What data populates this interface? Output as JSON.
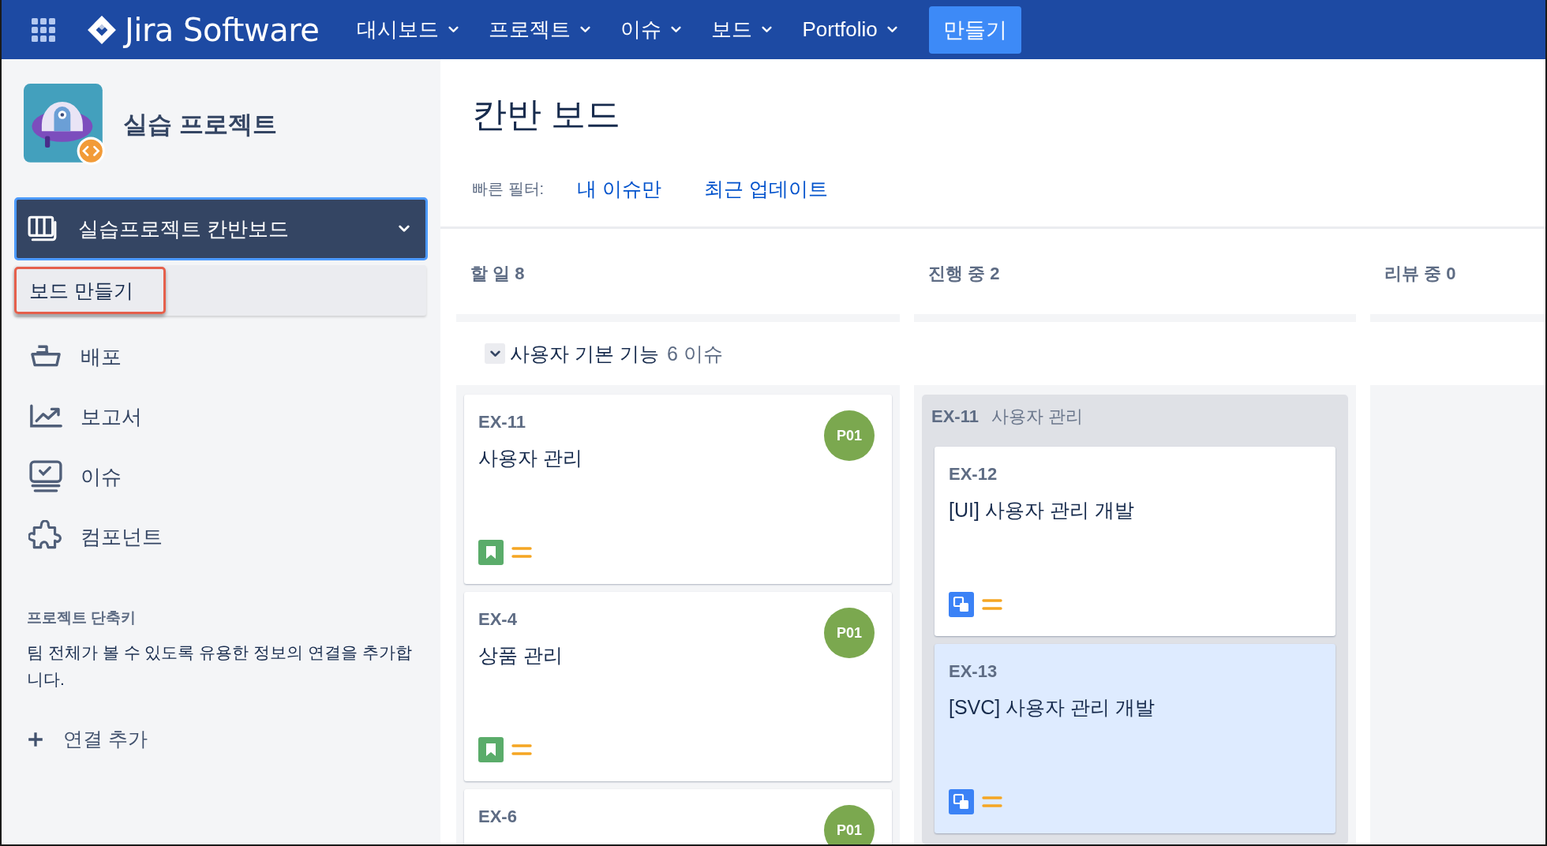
{
  "top_nav": {
    "logo": "Jira Software",
    "menus": [
      {
        "label": "대시보드",
        "dropdown": true
      },
      {
        "label": "프로젝트",
        "dropdown": true
      },
      {
        "label": "이슈",
        "dropdown": true
      },
      {
        "label": "보드",
        "dropdown": true
      },
      {
        "label": "Portfolio",
        "dropdown": true
      }
    ],
    "create_button": "만들기"
  },
  "sidebar": {
    "project_name": "실습 프로젝트",
    "board_selector": {
      "label": "실습프로젝트 칸반보드",
      "expanded": true
    },
    "dropdown_items": [
      {
        "label": "보드 만들기",
        "highlighted": true
      }
    ],
    "items": [
      {
        "label": "배포",
        "kind": "ship"
      },
      {
        "label": "보고서",
        "kind": "chart"
      },
      {
        "label": "이슈",
        "kind": "issues"
      },
      {
        "label": "컴포넌트",
        "kind": "puzzle"
      }
    ],
    "shortcuts": {
      "heading": "프로젝트 단축키",
      "description": "팀 전체가 볼 수 있도록 유용한 정보의 연결을 추가합니다.",
      "add_link": "연결 추가"
    }
  },
  "board": {
    "title": "칸반 보드",
    "quick_filters": {
      "label": "빠른 필터:",
      "items": [
        "내 이슈만",
        "최근 업데이트"
      ]
    },
    "columns": [
      {
        "name": "할 일",
        "count": "8"
      },
      {
        "name": "진행 중",
        "count": "2"
      },
      {
        "name": "리뷰 중",
        "count": "0"
      }
    ],
    "swimlane": {
      "title": "사용자 기본 기능",
      "count": "6 이슈",
      "expanded": true
    },
    "lanes": [
      {
        "cards": [
          {
            "key": "EX-11",
            "title": "사용자 관리",
            "kind": "story",
            "assignee": "P01",
            "selected": false
          },
          {
            "key": "EX-4",
            "title": "상품 관리",
            "kind": "story",
            "assignee": "P01",
            "selected": false
          },
          {
            "key": "EX-6",
            "assignee": "P01",
            "selected": false
          }
        ]
      },
      {
        "parent": {
          "key": "EX-11",
          "title": "사용자 관리"
        },
        "cards": [
          {
            "key": "EX-12",
            "title": "[UI] 사용자 관리 개발",
            "kind": "subtask",
            "selected": false
          },
          {
            "key": "EX-13",
            "title": "[SVC] 사용자 관리 개발",
            "kind": "subtask",
            "selected": true
          }
        ]
      }
    ]
  }
}
